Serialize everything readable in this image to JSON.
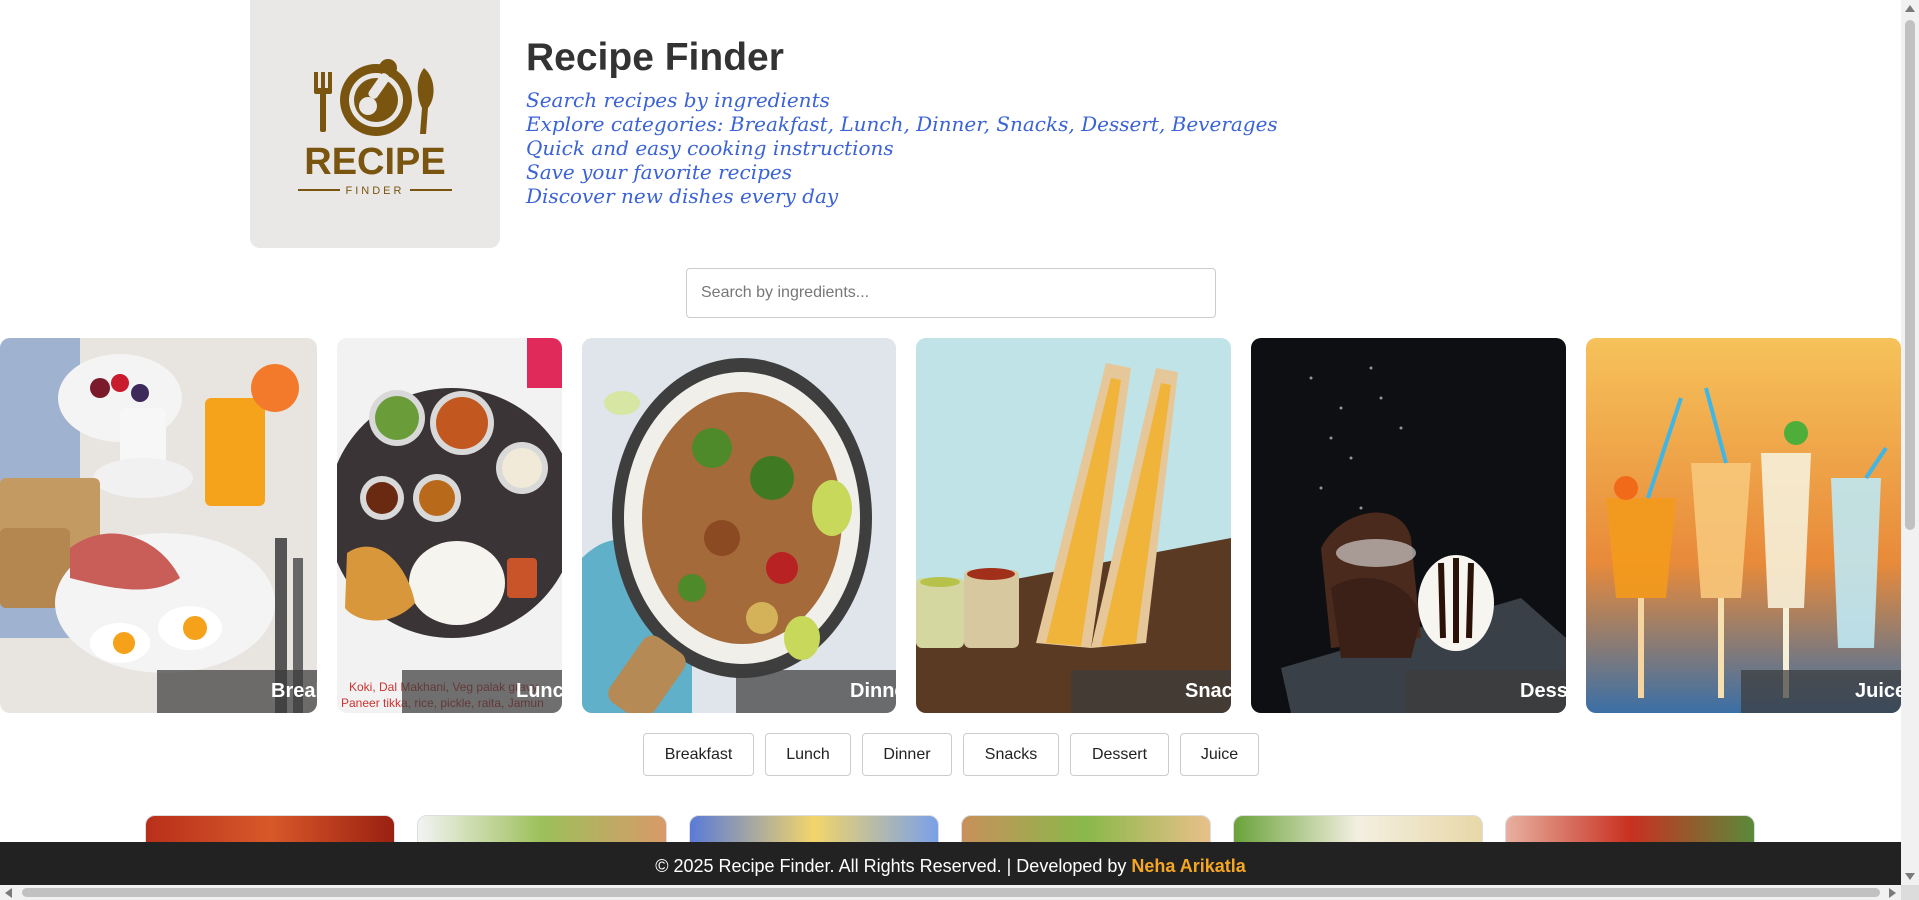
{
  "header": {
    "logo": {
      "icon": "plate-fork-knife-icon",
      "word": "RECIPE",
      "subword": "FINDER",
      "color": "#7a5510"
    },
    "title": "Recipe Finder",
    "taglines": [
      "Search recipes by ingredients",
      "Explore categories: Breakfast, Lunch, Dinner, Snacks, Dessert, Beverages",
      "Quick and easy cooking instructions",
      "Save your favorite recipes",
      "Discover new dishes every day"
    ]
  },
  "search": {
    "placeholder": "Search by ingredients...",
    "value": ""
  },
  "carousel": [
    {
      "label": "Breakfast",
      "image": "breakfast-photo"
    },
    {
      "label": "Lunch",
      "image": "lunch-thali-photo",
      "overlay_text": "Koki, Dal Makhani, Veg palak gravy, Paneer tikka, rice, pickle, raita, Jamun"
    },
    {
      "label": "Dinner",
      "image": "noodles-pan-photo"
    },
    {
      "label": "Snacks",
      "image": "sandwich-photo"
    },
    {
      "label": "Dessert",
      "image": "brownie-icecream-photo"
    },
    {
      "label": "Juice",
      "image": "juices-photo"
    }
  ],
  "category_buttons": [
    "Breakfast",
    "Lunch",
    "Dinner",
    "Snacks",
    "Dessert",
    "Juice"
  ],
  "recipe_thumbs": [
    "recipe-thumb-1",
    "recipe-thumb-2",
    "recipe-thumb-3",
    "recipe-thumb-4",
    "recipe-thumb-5",
    "recipe-thumb-6"
  ],
  "footer": {
    "text": "© 2025 Recipe Finder. All Rights Reserved. | Developed by",
    "developer": "Neha Arikatla",
    "developer_color": "#f5a623"
  }
}
